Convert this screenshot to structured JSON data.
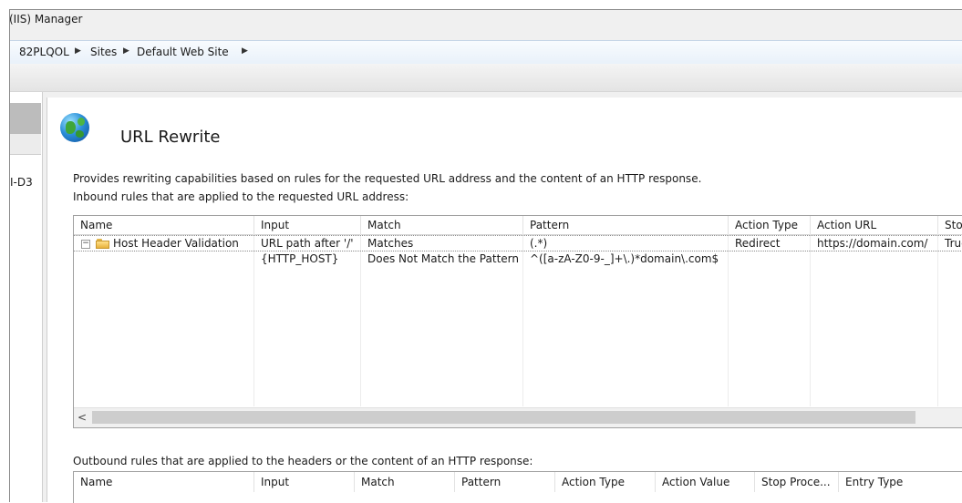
{
  "window": {
    "title": "(IIS) Manager"
  },
  "breadcrumb": {
    "items": [
      "82PLQOL",
      "Sites",
      "Default Web Site"
    ]
  },
  "left_pane": {
    "truncated_node": "I-D3"
  },
  "feature": {
    "title": "URL Rewrite",
    "icon": "globe-icon",
    "description": "Provides rewriting capabilities based on rules for the requested URL address and the content of an HTTP response."
  },
  "inbound": {
    "caption": "Inbound rules that are applied to the requested URL address:",
    "columns": [
      "Name",
      "Input",
      "Match",
      "Pattern",
      "Action Type",
      "Action URL",
      "Stop"
    ],
    "rows": [
      {
        "name": "Host Header Validation",
        "input": "URL path after '/'",
        "match": "Matches",
        "pattern": "(.*)",
        "action_type": "Redirect",
        "action_url": "https://domain.com/",
        "stop": "True"
      },
      {
        "name": "",
        "input": "{HTTP_HOST}",
        "match": "Does Not Match the Pattern",
        "pattern": "^([a-zA-Z0-9-_]+\\.)*domain\\.com$",
        "action_type": "",
        "action_url": "",
        "stop": ""
      }
    ]
  },
  "outbound": {
    "caption": "Outbound rules that are applied to the headers or the content of an HTTP response:",
    "columns": [
      "Name",
      "Input",
      "Match",
      "Pattern",
      "Action Type",
      "Action Value",
      "Stop Proce...",
      "Entry Type"
    ]
  },
  "scrollbar": {
    "left_arrow": "<"
  },
  "colors": {
    "address_bar": "#e9f1fa",
    "panel_bg": "#f0f0f0",
    "grid_border": "#a0a0a0"
  }
}
